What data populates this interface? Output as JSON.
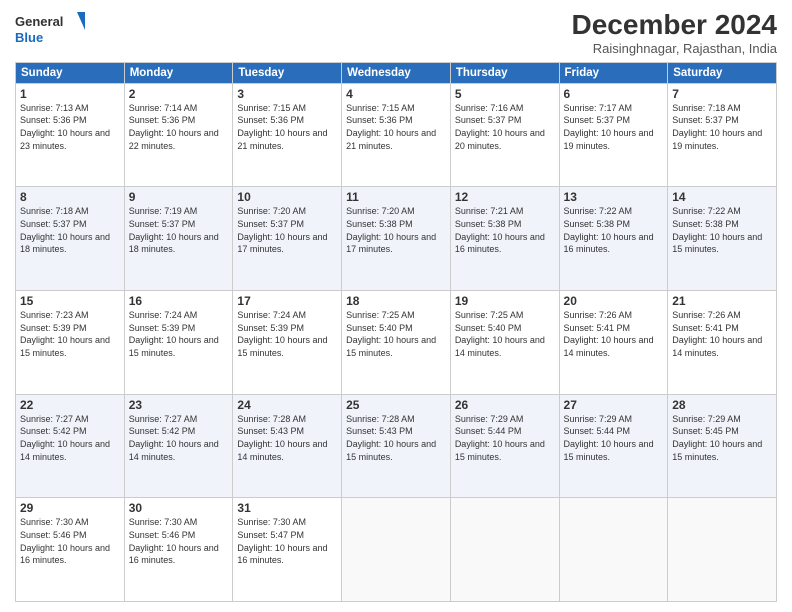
{
  "header": {
    "logo_line1": "General",
    "logo_line2": "Blue",
    "month_title": "December 2024",
    "location": "Raisinghnagar, Rajasthan, India"
  },
  "days_of_week": [
    "Sunday",
    "Monday",
    "Tuesday",
    "Wednesday",
    "Thursday",
    "Friday",
    "Saturday"
  ],
  "weeks": [
    [
      {
        "day": "1",
        "sunrise": "7:13 AM",
        "sunset": "5:36 PM",
        "daylight": "10 hours and 23 minutes."
      },
      {
        "day": "2",
        "sunrise": "7:14 AM",
        "sunset": "5:36 PM",
        "daylight": "10 hours and 22 minutes."
      },
      {
        "day": "3",
        "sunrise": "7:15 AM",
        "sunset": "5:36 PM",
        "daylight": "10 hours and 21 minutes."
      },
      {
        "day": "4",
        "sunrise": "7:15 AM",
        "sunset": "5:36 PM",
        "daylight": "10 hours and 21 minutes."
      },
      {
        "day": "5",
        "sunrise": "7:16 AM",
        "sunset": "5:37 PM",
        "daylight": "10 hours and 20 minutes."
      },
      {
        "day": "6",
        "sunrise": "7:17 AM",
        "sunset": "5:37 PM",
        "daylight": "10 hours and 19 minutes."
      },
      {
        "day": "7",
        "sunrise": "7:18 AM",
        "sunset": "5:37 PM",
        "daylight": "10 hours and 19 minutes."
      }
    ],
    [
      {
        "day": "8",
        "sunrise": "7:18 AM",
        "sunset": "5:37 PM",
        "daylight": "10 hours and 18 minutes."
      },
      {
        "day": "9",
        "sunrise": "7:19 AM",
        "sunset": "5:37 PM",
        "daylight": "10 hours and 18 minutes."
      },
      {
        "day": "10",
        "sunrise": "7:20 AM",
        "sunset": "5:37 PM",
        "daylight": "10 hours and 17 minutes."
      },
      {
        "day": "11",
        "sunrise": "7:20 AM",
        "sunset": "5:38 PM",
        "daylight": "10 hours and 17 minutes."
      },
      {
        "day": "12",
        "sunrise": "7:21 AM",
        "sunset": "5:38 PM",
        "daylight": "10 hours and 16 minutes."
      },
      {
        "day": "13",
        "sunrise": "7:22 AM",
        "sunset": "5:38 PM",
        "daylight": "10 hours and 16 minutes."
      },
      {
        "day": "14",
        "sunrise": "7:22 AM",
        "sunset": "5:38 PM",
        "daylight": "10 hours and 15 minutes."
      }
    ],
    [
      {
        "day": "15",
        "sunrise": "7:23 AM",
        "sunset": "5:39 PM",
        "daylight": "10 hours and 15 minutes."
      },
      {
        "day": "16",
        "sunrise": "7:24 AM",
        "sunset": "5:39 PM",
        "daylight": "10 hours and 15 minutes."
      },
      {
        "day": "17",
        "sunrise": "7:24 AM",
        "sunset": "5:39 PM",
        "daylight": "10 hours and 15 minutes."
      },
      {
        "day": "18",
        "sunrise": "7:25 AM",
        "sunset": "5:40 PM",
        "daylight": "10 hours and 15 minutes."
      },
      {
        "day": "19",
        "sunrise": "7:25 AM",
        "sunset": "5:40 PM",
        "daylight": "10 hours and 14 minutes."
      },
      {
        "day": "20",
        "sunrise": "7:26 AM",
        "sunset": "5:41 PM",
        "daylight": "10 hours and 14 minutes."
      },
      {
        "day": "21",
        "sunrise": "7:26 AM",
        "sunset": "5:41 PM",
        "daylight": "10 hours and 14 minutes."
      }
    ],
    [
      {
        "day": "22",
        "sunrise": "7:27 AM",
        "sunset": "5:42 PM",
        "daylight": "10 hours and 14 minutes."
      },
      {
        "day": "23",
        "sunrise": "7:27 AM",
        "sunset": "5:42 PM",
        "daylight": "10 hours and 14 minutes."
      },
      {
        "day": "24",
        "sunrise": "7:28 AM",
        "sunset": "5:43 PM",
        "daylight": "10 hours and 14 minutes."
      },
      {
        "day": "25",
        "sunrise": "7:28 AM",
        "sunset": "5:43 PM",
        "daylight": "10 hours and 15 minutes."
      },
      {
        "day": "26",
        "sunrise": "7:29 AM",
        "sunset": "5:44 PM",
        "daylight": "10 hours and 15 minutes."
      },
      {
        "day": "27",
        "sunrise": "7:29 AM",
        "sunset": "5:44 PM",
        "daylight": "10 hours and 15 minutes."
      },
      {
        "day": "28",
        "sunrise": "7:29 AM",
        "sunset": "5:45 PM",
        "daylight": "10 hours and 15 minutes."
      }
    ],
    [
      {
        "day": "29",
        "sunrise": "7:30 AM",
        "sunset": "5:46 PM",
        "daylight": "10 hours and 16 minutes."
      },
      {
        "day": "30",
        "sunrise": "7:30 AM",
        "sunset": "5:46 PM",
        "daylight": "10 hours and 16 minutes."
      },
      {
        "day": "31",
        "sunrise": "7:30 AM",
        "sunset": "5:47 PM",
        "daylight": "10 hours and 16 minutes."
      },
      null,
      null,
      null,
      null
    ]
  ]
}
